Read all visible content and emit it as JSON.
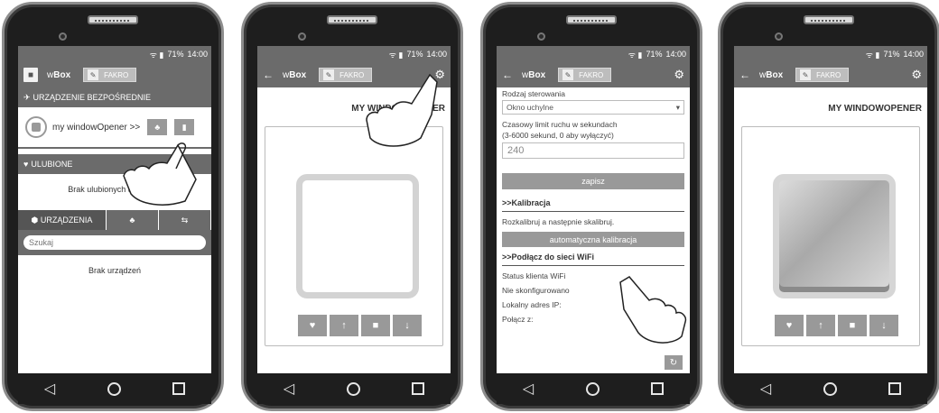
{
  "status": {
    "battery": "71%",
    "time": "14:00",
    "signal": "ᯤ ▮"
  },
  "app": {
    "brand_prefix": "w",
    "brand_bold": "Box",
    "account": "FAKRO"
  },
  "icons": {
    "menu": "■",
    "back": "←",
    "key": "🔑",
    "gear": "⚙",
    "nav_back": "◁"
  },
  "screen1": {
    "direct_header": "URZĄDZENIE BEZPOŚREDNIE",
    "device_name": "my windowOpener >>",
    "favorites_header": "ULUBIONE",
    "favorites_empty": "Brak ulubionych urządzeń",
    "tabs": [
      "URZĄDZENIA",
      "♣",
      "⇆"
    ],
    "search_placeholder": "Szukaj",
    "devices_empty": "Brak urządzeń"
  },
  "screen2": {
    "title": "MY WINDOWOPENER",
    "controls": [
      "♥",
      "↑",
      "■",
      "↓"
    ]
  },
  "screen3": {
    "control_type_label": "Rodzaj sterowania",
    "control_type_value": "Okno uchylne",
    "time_limit_label": "Czasowy limit ruchu w sekundach",
    "time_limit_hint": "(3-6000 sekund, 0 aby wyłączyć)",
    "time_limit_value": "240",
    "save_label": "zapisz",
    "calibration_header": ">>Kalibracja",
    "calibration_text": "Rozkalibruj a następnie skalibruj.",
    "auto_calibration_label": "automatyczna kalibracja",
    "wifi_header": ">>Podłącz do sieci WiFi",
    "wifi_client_status": "Status klienta WiFi",
    "wifi_not_configured": "Nie skonfigurowano",
    "local_ip": "Lokalny adres IP:",
    "connect_with": "Połącz z:"
  },
  "screen4": {
    "title": "MY WINDOWOPENER",
    "controls": [
      "♥",
      "↑",
      "■",
      "↓"
    ]
  }
}
